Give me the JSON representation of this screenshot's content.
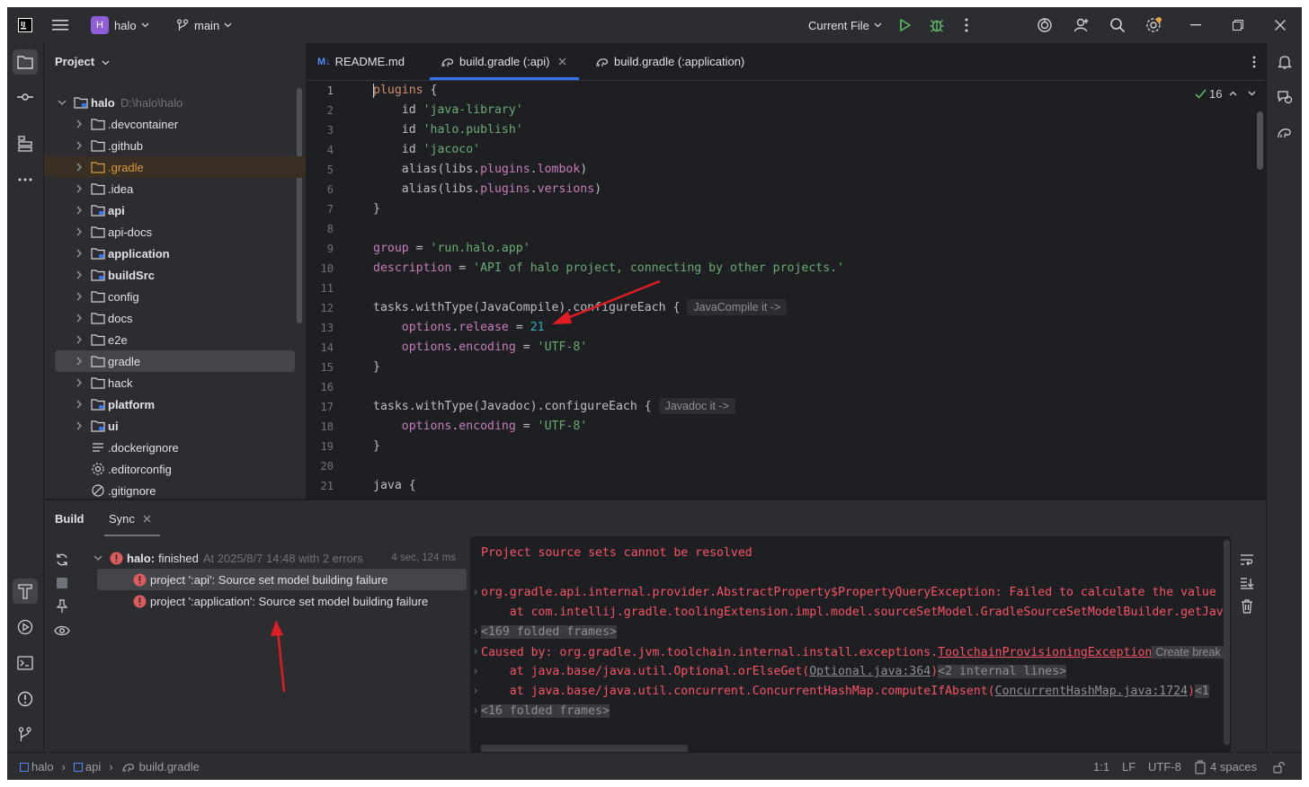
{
  "titlebar": {
    "project_badge": "H",
    "project_name": "halo",
    "branch": "main",
    "run_config": "Current File"
  },
  "project_panel": {
    "title": "Project",
    "root_name": "halo",
    "root_path": "D:\\halo\\halo",
    "items": [
      {
        "label": ".devcontainer"
      },
      {
        "label": ".github"
      },
      {
        "label": ".gradle"
      },
      {
        "label": ".idea"
      },
      {
        "label": "api"
      },
      {
        "label": "api-docs"
      },
      {
        "label": "application"
      },
      {
        "label": "buildSrc"
      },
      {
        "label": "config"
      },
      {
        "label": "docs"
      },
      {
        "label": "e2e"
      },
      {
        "label": "gradle"
      },
      {
        "label": "hack"
      },
      {
        "label": "platform"
      },
      {
        "label": "ui"
      },
      {
        "label": ".dockerignore"
      },
      {
        "label": ".editorconfig"
      },
      {
        "label": ".gitignore"
      }
    ]
  },
  "editor": {
    "tabs": [
      {
        "label": "README.md"
      },
      {
        "label": "build.gradle (:api)"
      },
      {
        "label": "build.gradle (:application)"
      }
    ],
    "readme_prefix": "M↓",
    "problems_count": "16",
    "line_numbers": [
      "1",
      "2",
      "3",
      "4",
      "5",
      "6",
      "7",
      "8",
      "9",
      "10",
      "11",
      "12",
      "13",
      "14",
      "15",
      "16",
      "17",
      "18",
      "19",
      "20",
      "21"
    ],
    "code": {
      "l1a": "plugins",
      "l1b": " {",
      "l2a": "    id ",
      "l2b": "'java-library'",
      "l3a": "    id ",
      "l3b": "'halo.publish'",
      "l4a": "    id ",
      "l4b": "'jacoco'",
      "l5a": "    alias(libs.",
      "l5b": "plugins",
      "l5c": ".",
      "l5d": "lombok",
      "l5e": ")",
      "l6a": "    alias(libs.",
      "l6b": "plugins",
      "l6c": ".",
      "l6d": "versions",
      "l6e": ")",
      "l7": "}",
      "l9a": "group",
      "l9b": " = ",
      "l9c": "'run.halo.app'",
      "l10a": "description",
      "l10b": " = ",
      "l10c": "'API of halo project, connecting by other projects.'",
      "l12a": "tasks.withType(JavaCompile).configureEach {",
      "l12hint": "JavaCompile it ->",
      "l13a": "    ",
      "l13b": "options",
      "l13c": ".",
      "l13d": "release",
      "l13e": " = ",
      "l13f": "21",
      "l14a": "    ",
      "l14b": "options",
      "l14c": ".",
      "l14d": "encoding",
      "l14e": " = ",
      "l14f": "'UTF-8'",
      "l15": "}",
      "l17a": "tasks.withType(Javadoc).configureEach {",
      "l17hint": "Javadoc it ->",
      "l18a": "    ",
      "l18b": "options",
      "l18c": ".",
      "l18d": "encoding",
      "l18e": " = ",
      "l18f": "'UTF-8'",
      "l19": "}",
      "l21": "java {"
    }
  },
  "build": {
    "tab_build": "Build",
    "tab_sync": "Sync",
    "root_label": "halo:",
    "root_status": "finished",
    "root_meta": "At 2025/8/7 14:48 with 2 errors",
    "root_time": "4 sec, 124 ms",
    "errors": [
      {
        "label": "project ':api': Source set model building failure"
      },
      {
        "label": "project ':application': Source set model building failure"
      }
    ],
    "console": {
      "c1": "Project source sets cannot be resolved",
      "c3": "org.gradle.api.internal.provider.AbstractProperty$PropertyQueryException: Failed to calculate the value",
      "c4": "    at com.intellij.gradle.toolingExtension.impl.model.sourceSetModel.GradleSourceSetModelBuilder.getJav",
      "c5": "<169 folded frames>",
      "c6a": "Caused by: org.gradle.jvm.toolchain.internal.install.exceptions.",
      "c6b": "ToolchainProvisioningException",
      "c6c": "Create break",
      "c7a": "    at java.base/java.util.Optional.orElseGet(",
      "c7b": "Optional.java:364",
      "c7c": ")",
      "c7d": "<2 internal lines>",
      "c8a": "    at java.base/java.util.concurrent.ConcurrentHashMap.computeIfAbsent(",
      "c8b": "ConcurrentHashMap.java:1724",
      "c8c": ")",
      "c8d": "<1",
      "c9": "<16 folded frames>"
    }
  },
  "statusbar": {
    "crumb1": "halo",
    "crumb2": "api",
    "crumb3": "build.gradle",
    "position": "1:1",
    "line_sep": "LF",
    "encoding": "UTF-8",
    "indent": "4 spaces"
  },
  "colors": {
    "accent": "#3574f0",
    "error": "#f75464",
    "annotation_arrow": "#e01b24"
  }
}
